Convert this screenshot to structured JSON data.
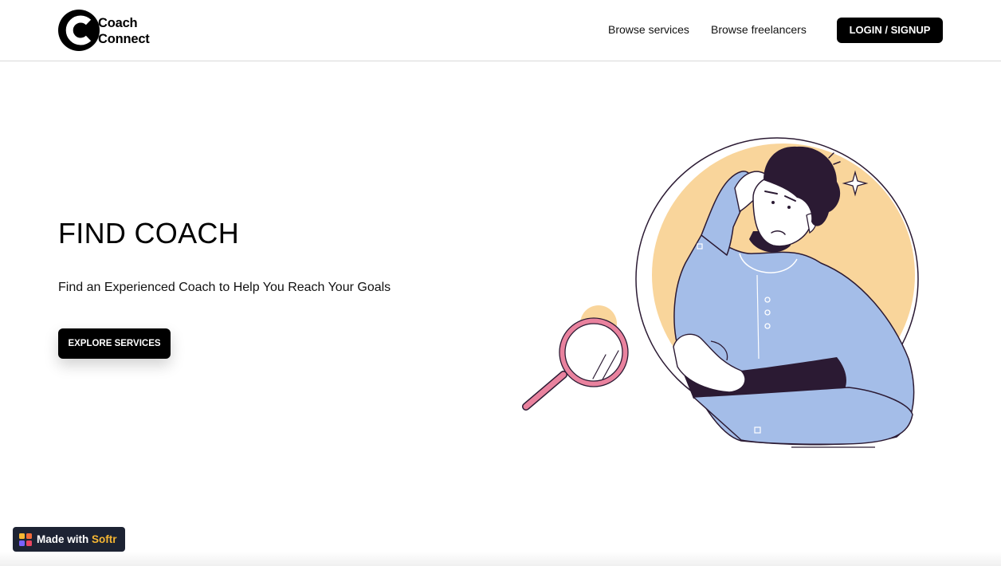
{
  "brand": {
    "line1": "Coach",
    "line2": "Connect"
  },
  "nav": {
    "browse_services": "Browse services",
    "browse_freelancers": "Browse freelancers",
    "login_signup": "LOGIN / SIGNUP"
  },
  "hero": {
    "title": "FIND COACH",
    "subtitle": "Find an Experienced Coach to Help You Reach Your Goals",
    "cta_label": "EXPLORE SERVICES"
  },
  "badge": {
    "prefix": "Made with",
    "brand": "Softr"
  },
  "colors": {
    "accent_peach": "#f9d59b",
    "shirt_blue": "#a4bde8",
    "hair_dark": "#2b1a33",
    "magnifier_pink": "#e9829e"
  },
  "icons": {
    "logo": "coach-connect-logo-icon",
    "badge": "softr-logo-icon"
  }
}
